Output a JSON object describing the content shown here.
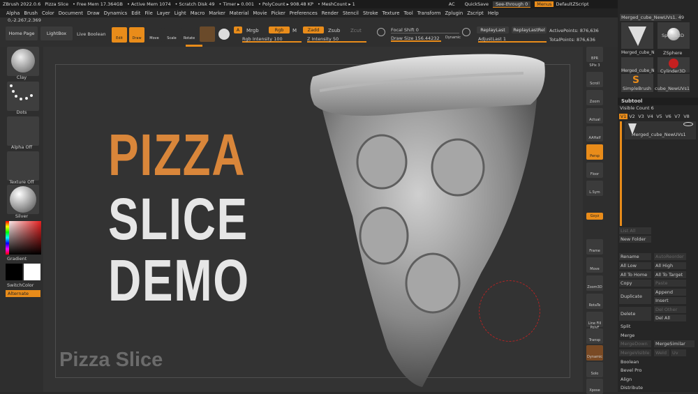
{
  "titlebar": {
    "app": "ZBrush 2022.0.6",
    "doc": "Pizza Slice",
    "free_mem": "• Free Mem 17.364GB",
    "active_mem": "• Active Mem 1074",
    "scratch": "• Scratch Disk 49",
    "timer": "• Timer ▸ 0.001",
    "polycount": "• PolyCount ▸ 908.48 KP",
    "meshcount": "• MeshCount ▸ 1",
    "ac": "AC",
    "quicksave": "QuickSave",
    "seethrough": "See-through 0",
    "menus": "Menus",
    "script": "DefaultZScript"
  },
  "menu": [
    "Alpha",
    "Brush",
    "Color",
    "Document",
    "Draw",
    "Dynamics",
    "Edit",
    "File",
    "Layer",
    "Light",
    "Macro",
    "Marker",
    "Material",
    "Movie",
    "Picker",
    "Preferences",
    "Render",
    "Stencil",
    "Stroke",
    "Texture",
    "Tool",
    "Transform",
    "Zplugin",
    "Zscript",
    "Help"
  ],
  "coords": "0,-2.267,2.369",
  "top": {
    "home": "Home Page",
    "lightbox": "LightBox",
    "liveboolean": "Live Boolean",
    "edit": "Edit",
    "draw": "Draw",
    "move": "Move",
    "scale": "Scale",
    "rotate": "Rotate",
    "a": "A",
    "mrgb": "Mrgb",
    "rgb": "Rgb",
    "m": "M",
    "rgb_intensity": "Rgb Intensity 100",
    "zadd": "Zadd",
    "zsub": "Zsub",
    "zcut": "Zcut",
    "z_intensity": "Z Intensity 50",
    "focal_shift": "Focal Shift 0",
    "draw_size": "Draw Size 156.44232",
    "dynamic": "Dynamic",
    "replaylast": "ReplayLast",
    "replaylastrel": "ReplayLastRel",
    "adjustlast": "AdjustLast 1",
    "activepoints": "ActivePoints: 876,636",
    "totalpoints": "TotalPoints: 876,636"
  },
  "left": {
    "clay": "Clay",
    "dots": "Dots",
    "alpha": "Alpha Off",
    "texture": "Texture Off",
    "material": "Silver",
    "gradient": "Gradient",
    "switchcolor": "SwitchColor",
    "alternate": "Alternate"
  },
  "canvas": {
    "line1": "PIZZA",
    "line2": "SLICE",
    "line3": "DEMO",
    "subtitle": "Pizza Slice"
  },
  "rightshelf": [
    "BPR",
    "SPix 3",
    "Scroll",
    "Zoom",
    "Actual",
    "AAHalf",
    "Persp",
    "Floor",
    "L.Sym",
    "Gxyz",
    "Frame",
    "Move",
    "Zoom3D",
    "RotaTe",
    "Line Fill PolyF",
    "Transp",
    "Dynamic",
    "Solo",
    "Xpose"
  ],
  "tray": {
    "tool_name": "Merged_cube_NewUVs1. 49",
    "tools": [
      "Merged_cube_N",
      "Sphere3D",
      "Merged_cube_N",
      "ZSphere",
      "SimpleBrush",
      "Cylinder3D",
      "cube_NewUVs1"
    ],
    "subtool": "Subtool",
    "visible": "Visible Count 6",
    "versions": [
      "V1",
      "V2",
      "V3",
      "V4",
      "V5",
      "V6",
      "V7",
      "V8"
    ],
    "item": "Merged_cube_NewUVs1",
    "listall": "List All",
    "newfolder": "New Folder",
    "rename": "Rename",
    "autoreorder": "AutoReorder",
    "alllow": "All Low",
    "allhigh": "All High",
    "alltohome": "All To Home",
    "alltotarget": "All To Target",
    "copy": "Copy",
    "paste": "Paste",
    "append": "Append",
    "duplicate": "Duplicate",
    "insert": "Insert",
    "delete": "Delete",
    "delother": "Del Other",
    "delall": "Del All",
    "split": "Split",
    "merge": "Merge",
    "mergedown": "MergeDown",
    "mergesimilar": "MergeSimilar",
    "mergevisible": "MergeVisible",
    "weld": "Weld",
    "uv": "Uv",
    "boolean": "Boolean",
    "bevelpro": "Bevel Pro",
    "align": "Align",
    "distribute": "Distribute"
  }
}
